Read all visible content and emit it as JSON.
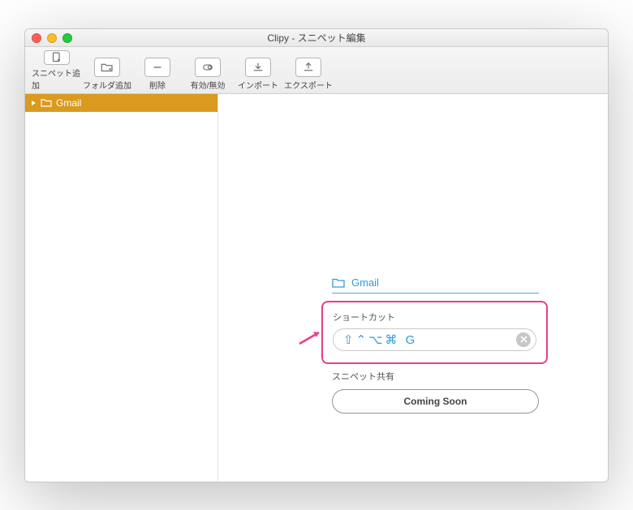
{
  "window": {
    "title": "Clipy - スニペット編集"
  },
  "toolbar": [
    {
      "label": "スニペット追加",
      "name": "add-snippet-button",
      "icon": "file-plus"
    },
    {
      "label": "フォルダ追加",
      "name": "add-folder-button",
      "icon": "folder-plus"
    },
    {
      "label": "削除",
      "name": "delete-button",
      "icon": "minus"
    },
    {
      "label": "有効/無効",
      "name": "toggle-enabled-button",
      "icon": "toggle"
    },
    {
      "label": "インポート",
      "name": "import-button",
      "icon": "import"
    },
    {
      "label": "エクスポート",
      "name": "export-button",
      "icon": "export"
    }
  ],
  "sidebar": {
    "items": [
      {
        "label": "Gmail"
      }
    ]
  },
  "detail": {
    "name": "Gmail",
    "shortcut_label": "ショートカット",
    "shortcut_value": "⇧⌃⌥⌘ G",
    "share_label": "スニペット共有",
    "share_button": "Coming Soon"
  },
  "colors": {
    "accent": "#3399e0",
    "selection": "#d99a1f",
    "highlight": "#e83e8c"
  }
}
